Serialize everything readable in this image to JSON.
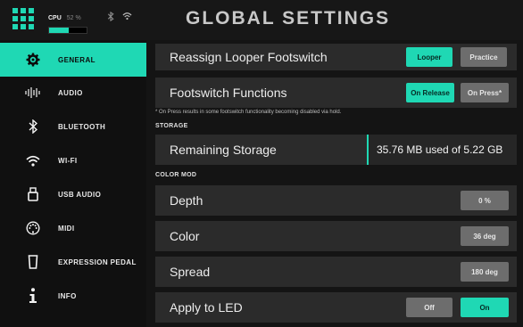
{
  "app": {
    "title": "GLOBAL SETTINGS",
    "accent_color": "#1fd8b4"
  },
  "header": {
    "menu_icon": "grid-menu-icon",
    "cpu_label": "CPU",
    "cpu_percent_text": "52 %",
    "cpu_load_fraction": 0.52,
    "bluetooth_icon": "bluetooth-icon",
    "wifi_icon": "wifi-icon"
  },
  "sidebar": {
    "items": [
      {
        "label": "GENERAL",
        "icon": "gear-icon",
        "active": true
      },
      {
        "label": "AUDIO",
        "icon": "audio-waveform-icon",
        "active": false
      },
      {
        "label": "BLUETOOTH",
        "icon": "bluetooth-icon",
        "active": false
      },
      {
        "label": "WI-FI",
        "icon": "wifi-icon",
        "active": false
      },
      {
        "label": "USB AUDIO",
        "icon": "usb-icon",
        "active": false
      },
      {
        "label": "MIDI",
        "icon": "midi-connector-icon",
        "active": false
      },
      {
        "label": "EXPRESSION PEDAL",
        "icon": "expression-pedal-icon",
        "active": false
      },
      {
        "label": "INFO",
        "icon": "info-icon",
        "active": false
      }
    ]
  },
  "general": {
    "looper_footswitch": {
      "label": "Reassign Looper Footswitch",
      "options": [
        "Looper",
        "Practice"
      ],
      "selected": "Looper"
    },
    "footswitch_functions": {
      "label": "Footswitch Functions",
      "options": [
        "On Release",
        "On Press*"
      ],
      "selected": "On Release"
    },
    "footnote": "* On Press results in some footswitch functionality becoming disabled via hold.",
    "storage_section": "STORAGE",
    "storage": {
      "label": "Remaining Storage",
      "value": "35.76 MB used of 5.22 GB"
    },
    "color_mod_section": "COLOR MOD",
    "depth": {
      "label": "Depth",
      "value": "0 %"
    },
    "color": {
      "label": "Color",
      "value": "36 deg"
    },
    "spread": {
      "label": "Spread",
      "value": "180 deg"
    },
    "apply_to_led": {
      "label": "Apply to LED",
      "options": [
        "Off",
        "On"
      ],
      "selected": "On"
    }
  }
}
